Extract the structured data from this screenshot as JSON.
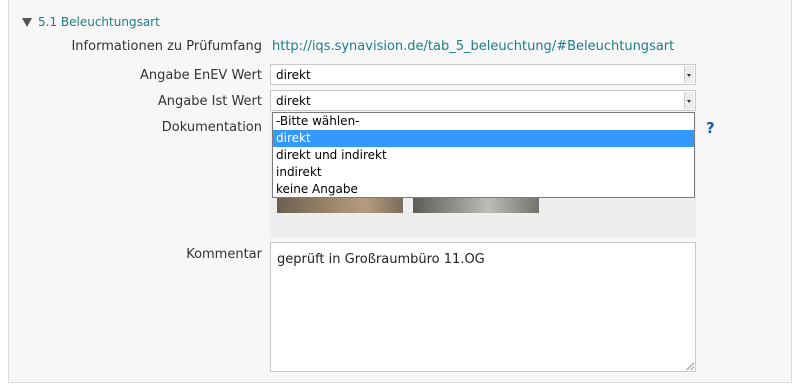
{
  "section": {
    "title": "5.1 Beleuchtungsart"
  },
  "fields": {
    "info_label": "Informationen zu Prüfumfang",
    "info_link": "http://iqs.synavision.de/tab_5_beleuchtung/#Beleuchtungsart",
    "enev_label": "Angabe EnEV Wert",
    "enev_value": "direkt",
    "ist_label": "Angabe Ist Wert",
    "ist_value": "direkt",
    "doc_label": "Dokumentation",
    "comment_label": "Kommentar",
    "comment_value": "geprüft in Großraumbüro 11.OG"
  },
  "dropdown": {
    "options": [
      "-Bitte wählen-",
      "direkt",
      "direkt und indirekt",
      "indirekt",
      "keine Angabe"
    ],
    "selected": "direkt"
  },
  "help": {
    "glyph": "?"
  },
  "colors": {
    "link": "#1a7f86",
    "selection": "#3399ff",
    "help": "#1b5fa8"
  }
}
